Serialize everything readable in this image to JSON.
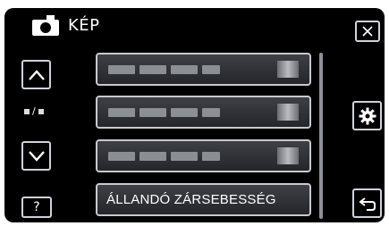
{
  "header": {
    "title": "KÉP",
    "icon": "camera-icon"
  },
  "nav": {
    "page_indicator": "/",
    "up_icon": "chevron-up-icon",
    "down_icon": "chevron-down-icon",
    "help_label": "?"
  },
  "menu": {
    "items": [
      {
        "label": "",
        "blurred": true
      },
      {
        "label": "",
        "blurred": true
      },
      {
        "label": "",
        "blurred": true
      },
      {
        "label": "ÁLLANDÓ ZÁRSEBESSÉG"
      }
    ]
  },
  "right": {
    "close_icon": "close-icon",
    "settings_icon": "gear-icon",
    "back_icon": "return-icon"
  },
  "colors": {
    "background": "#000000",
    "button_border": "#cfd3da",
    "item_border": "#c6c9cf",
    "item_fill": "#2e3035"
  }
}
